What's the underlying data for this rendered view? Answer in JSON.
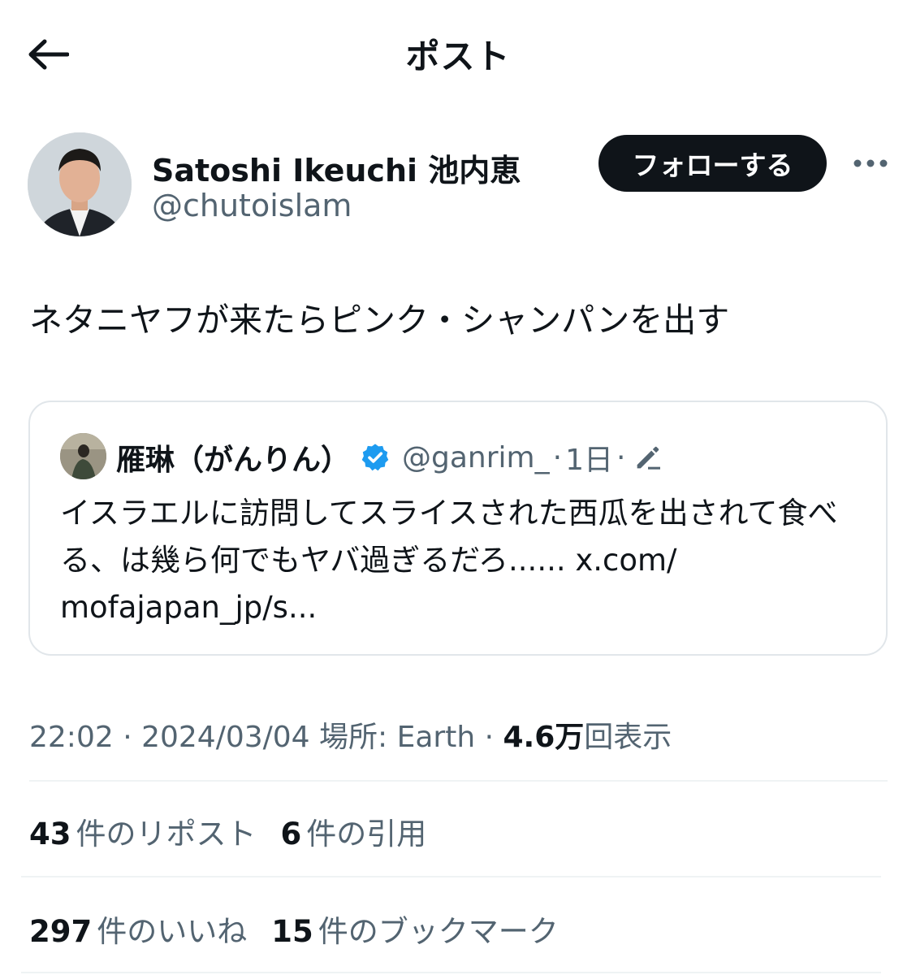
{
  "header": {
    "title": "ポスト",
    "back_icon": "arrow-left-icon"
  },
  "author": {
    "display_name": "Satoshi Ikeuchi 池内恵",
    "handle": "@chutoislam",
    "follow_label": "フォローする",
    "more_icon": "more-horizontal-icon"
  },
  "post": {
    "text": "ネタニヤフが来たらピンク・シャンパンを出す"
  },
  "quote": {
    "name": "雁琳（がんりん）",
    "verified_icon": "verified-badge-icon",
    "handle": "@ganrim_",
    "separator": "·",
    "time": "1日",
    "edit_icon": "edit-pen-icon",
    "text": "イスラエルに訪問してスライスされた西瓜を出されて食べる、は幾ら何でもヤバ過ぎるだろ...... x.com/ mofajapan_jp/s..."
  },
  "meta": {
    "time": "22:02",
    "sep1": " · ",
    "date": "2024/03/04",
    "location_label": " 場所: Earth",
    "sep2": " · ",
    "views_count": "4.6万",
    "views_label": "回表示"
  },
  "stats": {
    "reposts_count": "43",
    "reposts_label": "件のリポスト",
    "quotes_count": "6",
    "quotes_label": "件の引用",
    "likes_count": "297",
    "likes_label": "件のいいね",
    "bookmarks_count": "15",
    "bookmarks_label": "件のブックマーク"
  },
  "colors": {
    "text_primary": "#0f1419",
    "text_secondary": "#536471",
    "verified_blue": "#1d9bf0",
    "follow_bg": "#0f1419",
    "border": "#e1e6ea"
  }
}
